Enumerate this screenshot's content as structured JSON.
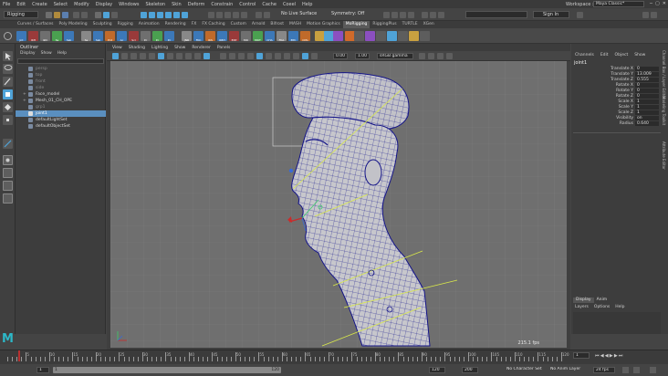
{
  "menubar": {
    "items": [
      "File",
      "Edit",
      "Create",
      "Select",
      "Modify",
      "Display",
      "Windows",
      "Skeleton",
      "Skin",
      "Deform",
      "Constrain",
      "Control",
      "Cache",
      "Coeel",
      "Help"
    ],
    "workspace_label": "Workspace :",
    "workspace_value": "Maya Classic*"
  },
  "statusline": {
    "mode": "Rigging",
    "live_surface": "No Live Surface",
    "symmetry": "Symmetry: Off",
    "sign_in": "Sign In"
  },
  "shelf": {
    "tabs": [
      "Curves / Surfaces",
      "Poly Modeling",
      "Sculpting",
      "Rigging",
      "Animation",
      "Rendering",
      "FX",
      "FX Caching",
      "Custom",
      "Arnold",
      "Bifrost",
      "MASH",
      "Motion Graphics",
      "MoRigging",
      "RiggingPlus",
      "TURTLE",
      "XGen"
    ],
    "active_tab": "MoRigging",
    "button_labels": [
      "Jnt",
      "IKH",
      "Ikhl",
      "Ss",
      "Ssb",
      "Ss",
      "Ssb",
      "Pnt",
      "Ac",
      "Scl",
      "Pc",
      "Pc",
      "Pc",
      "JNR",
      "FKC",
      "IKS",
      "RBH",
      "EXP",
      "MO",
      "MOT",
      "CHA",
      "FKA",
      "EPC",
      "CMo"
    ]
  },
  "outliner": {
    "title": "Outliner",
    "menu": [
      "Display",
      "Show",
      "Help"
    ],
    "items": [
      {
        "label": "persp",
        "dim": true,
        "indent": 0
      },
      {
        "label": "top",
        "dim": true,
        "indent": 0
      },
      {
        "label": "front",
        "dim": true,
        "indent": 0
      },
      {
        "label": "side",
        "dim": true,
        "indent": 0
      },
      {
        "label": "Face_model",
        "dim": false,
        "indent": 0,
        "expand": "+"
      },
      {
        "label": "Mesh_01_CH_OPE",
        "dim": false,
        "indent": 0,
        "expand": "+"
      },
      {
        "label": "grp1",
        "dim": true,
        "indent": 0
      },
      {
        "label": "joint1",
        "dim": false,
        "indent": 0,
        "selected": true
      },
      {
        "label": "defaultLightSet",
        "dim": false,
        "indent": 0
      },
      {
        "label": "defaultObjectSet",
        "dim": false,
        "indent": 0
      }
    ]
  },
  "viewport": {
    "menu": [
      "View",
      "Shading",
      "Lighting",
      "Show",
      "Renderer",
      "Panels"
    ],
    "field_a": "0.00",
    "field_b": "1.00",
    "colorspace": "sRGB gamma",
    "fps": "215.1 fps"
  },
  "channelbox": {
    "tabs": [
      "Channels",
      "Edit",
      "Object",
      "Show"
    ],
    "node_name": "joint1",
    "channels": [
      {
        "name": "Translate X",
        "value": "0"
      },
      {
        "name": "Translate Y",
        "value": "13.009"
      },
      {
        "name": "Translate Z",
        "value": "0.555"
      },
      {
        "name": "Rotate X",
        "value": "0"
      },
      {
        "name": "Rotate Y",
        "value": "0"
      },
      {
        "name": "Rotate Z",
        "value": "0"
      },
      {
        "name": "Scale X",
        "value": "1"
      },
      {
        "name": "Scale Y",
        "value": "1"
      },
      {
        "name": "Scale Z",
        "value": "1"
      },
      {
        "name": "Visibility",
        "value": "on"
      },
      {
        "name": "Radius",
        "value": "0.640"
      }
    ],
    "layer_tabs": [
      "Display",
      "Anim"
    ],
    "layer_menu": [
      "Layers",
      "Options",
      "Help"
    ],
    "side_tabs": [
      "Channel Box / Layer Editor",
      "Modeling Toolkit",
      "Attribute Editor"
    ]
  },
  "timeline": {
    "ticks": [
      "5",
      "10",
      "15",
      "20",
      "25",
      "30",
      "35",
      "40",
      "45",
      "50",
      "55",
      "60",
      "65",
      "70",
      "75",
      "80",
      "85",
      "90",
      "95",
      "100",
      "105",
      "110",
      "115",
      "120"
    ],
    "current_frame": "1",
    "range_start": "1",
    "range_inner_start": "1",
    "range_inner_end": "120",
    "range_end_a": "120",
    "range_end_b": "200",
    "character_set": "No Character Set",
    "anim_layer": "No Anim Layer",
    "fps": "24 fps"
  },
  "colors": {
    "accent": "#4fa3d8",
    "mesh_wire": "#14148c",
    "mesh_fill": "#c3c3c8",
    "joint_line": "#d9e84a",
    "playhead": "#b83030"
  }
}
